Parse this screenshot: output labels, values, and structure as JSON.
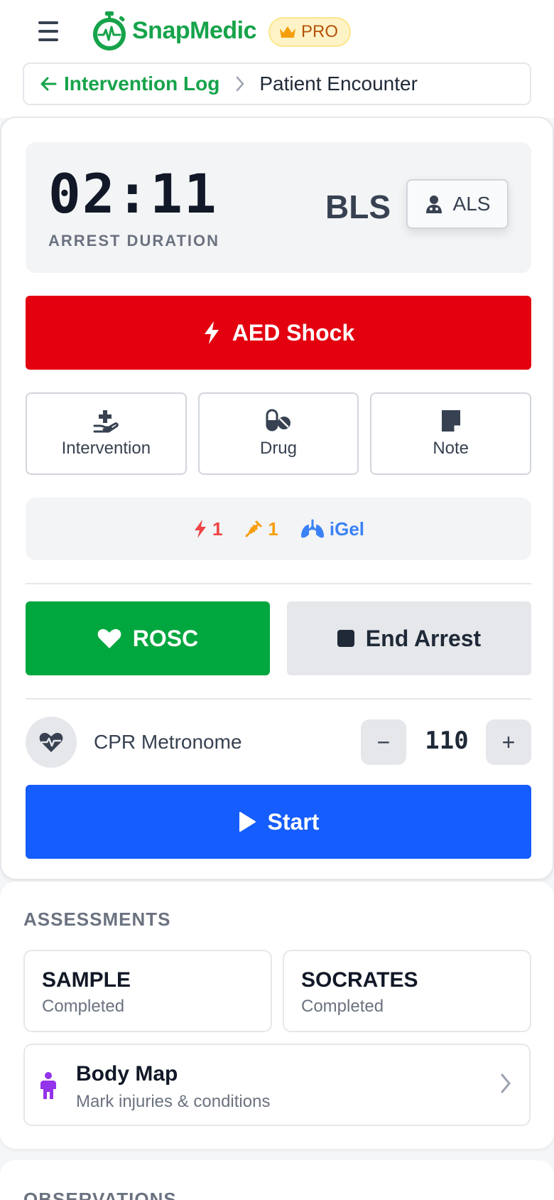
{
  "header": {
    "app_name": "SnapMedic",
    "pro_label": "PRO",
    "breadcrumb_back": "Intervention Log",
    "breadcrumb_current": "Patient Encounter"
  },
  "timer": {
    "value": "02:11",
    "label": "ARREST DURATION",
    "mode_current": "BLS",
    "mode_toggle": "ALS"
  },
  "actions": {
    "aed_shock": "AED Shock",
    "intervention": "Intervention",
    "drug": "Drug",
    "note": "Note"
  },
  "counters": {
    "shocks": "1",
    "drugs": "1",
    "airway": "iGel"
  },
  "outcome": {
    "rosc": "ROSC",
    "end_arrest": "End Arrest"
  },
  "metronome": {
    "label": "CPR Metronome",
    "minus": "−",
    "bpm": "110",
    "plus": "+",
    "start": "Start"
  },
  "assessments": {
    "title": "ASSESSMENTS",
    "items": [
      {
        "name": "SAMPLE",
        "status": "Completed"
      },
      {
        "name": "SOCRATES",
        "status": "Completed"
      }
    ],
    "body_map": {
      "title": "Body Map",
      "subtitle": "Mark injuries & conditions"
    }
  },
  "observations": {
    "title": "OBSERVATIONS"
  },
  "colors": {
    "brand_green": "#16a34a",
    "aed_red": "#e3000f",
    "rosc_green": "#00a63e",
    "start_blue": "#155dfc",
    "pro_gold": "#f59e0b"
  }
}
